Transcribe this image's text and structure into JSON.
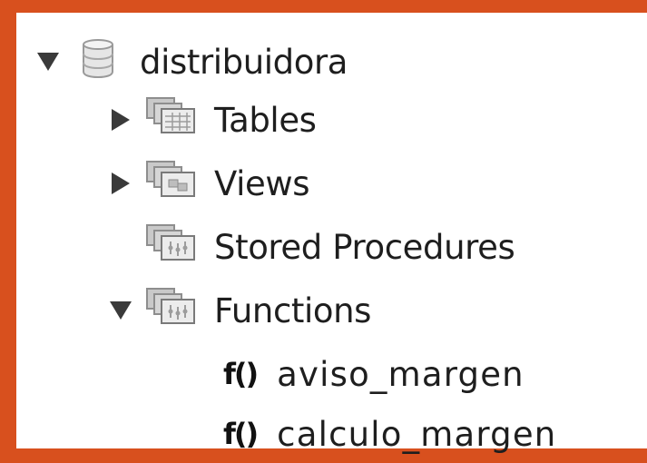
{
  "tree": {
    "schema": {
      "label": "distribuidora",
      "icon": "database-icon",
      "expanded": true
    },
    "groups": [
      {
        "label": "Tables",
        "icon": "tables-folder-icon",
        "expanded": false
      },
      {
        "label": "Views",
        "icon": "views-folder-icon",
        "expanded": false
      },
      {
        "label": "Stored Procedures",
        "icon": "procedures-folder-icon",
        "expanded": null
      },
      {
        "label": "Functions",
        "icon": "functions-folder-icon",
        "expanded": true
      }
    ],
    "functions": [
      {
        "icon_text": "f()",
        "label": "aviso_margen"
      },
      {
        "icon_text": "f()",
        "label": "calculo_margen"
      }
    ]
  },
  "colors": {
    "background": "#d8501e",
    "panel": "#ffffff",
    "text": "#1e1e1e",
    "arrow": "#3a3a3a"
  }
}
